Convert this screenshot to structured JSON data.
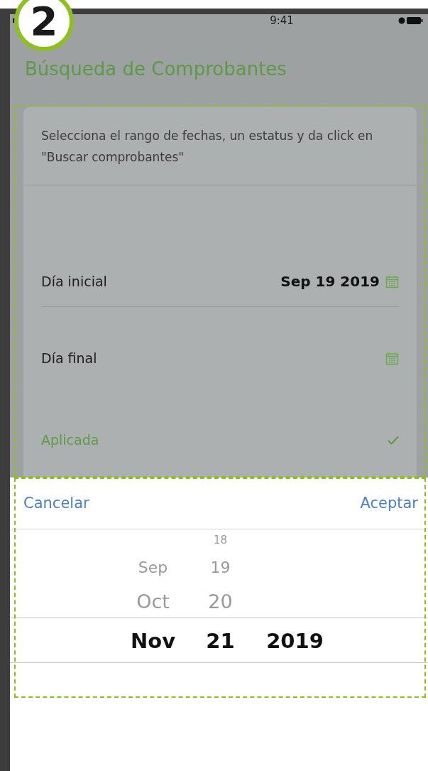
{
  "badge": {
    "label": "2"
  },
  "status_bar": {
    "time": "9:41"
  },
  "title": "Búsqueda de Comprobantes",
  "card": {
    "description": "Selecciona el rango de fechas, un estatus y da click en \"Buscar comprobantes\"",
    "fields": [
      {
        "label": "Día inicial",
        "value": "Sep 19 2019"
      },
      {
        "label": "Día final"
      }
    ],
    "status_options": [
      {
        "label": "Aplicada",
        "selected": true
      }
    ]
  },
  "date_picker": {
    "cancel": "Cancelar",
    "accept": "Aceptar",
    "columns": [
      {
        "kind": "month",
        "items": [
          {
            "label": "Sep",
            "selected": false
          },
          {
            "label": "Oct",
            "selected": false
          },
          {
            "label": "Nov",
            "selected": true
          }
        ]
      },
      {
        "kind": "day",
        "items": [
          {
            "label": "18",
            "selected": false
          },
          {
            "label": "19",
            "selected": false
          },
          {
            "label": "20",
            "selected": false
          },
          {
            "label": "21",
            "selected": true
          }
        ]
      },
      {
        "kind": "year",
        "items": [
          {
            "label": "2019",
            "selected": true
          }
        ]
      }
    ]
  }
}
